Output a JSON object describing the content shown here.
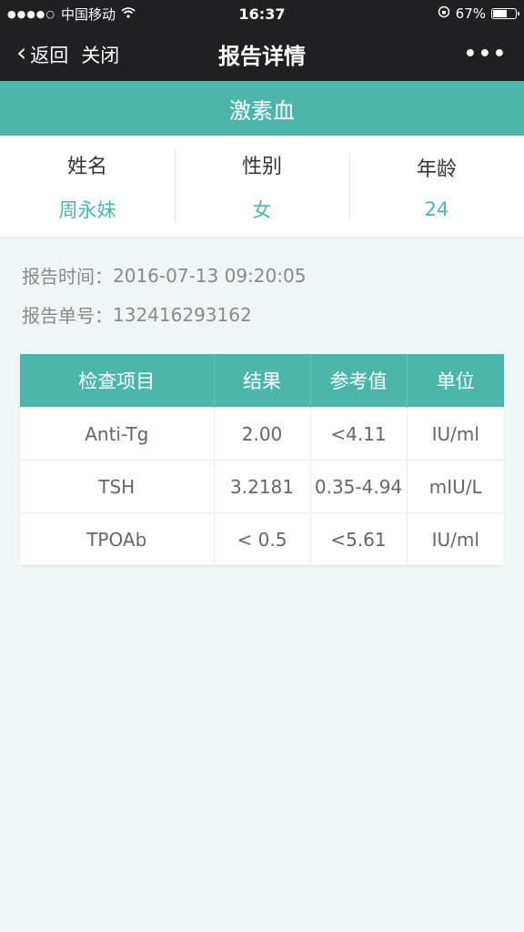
{
  "status_bar": {
    "carrier": "中国移动",
    "time": "16:37",
    "battery_percent": "67%",
    "battery_level": 0.67
  },
  "nav": {
    "back_label": "返回",
    "close_label": "关闭",
    "title": "报告详情",
    "more_label": "•••"
  },
  "report": {
    "type": "激素血"
  },
  "patient": {
    "name_label": "姓名",
    "name_value": "周永妹",
    "gender_label": "性别",
    "gender_value": "女",
    "age_label": "年龄",
    "age_value": "24"
  },
  "meta": {
    "time_label": "报告时间：",
    "time_value": "2016-07-13 09:20:05",
    "number_label": "报告单号：",
    "number_value": "132416293162"
  },
  "results_table": {
    "headers": [
      "检查项目",
      "结果",
      "参考值",
      "单位"
    ],
    "rows": [
      [
        "Anti-Tg",
        "2.00",
        "<4.11",
        "IU/ml"
      ],
      [
        "TSH",
        "3.2181",
        "0.35-4.94",
        "mIU/L"
      ],
      [
        "TPOAb",
        "< 0.5",
        "<5.61",
        "IU/ml"
      ]
    ]
  },
  "colors": {
    "accent": "#4db6ac",
    "nav_bg": "#1f1f24",
    "page_bg": "#f0f5f5"
  }
}
